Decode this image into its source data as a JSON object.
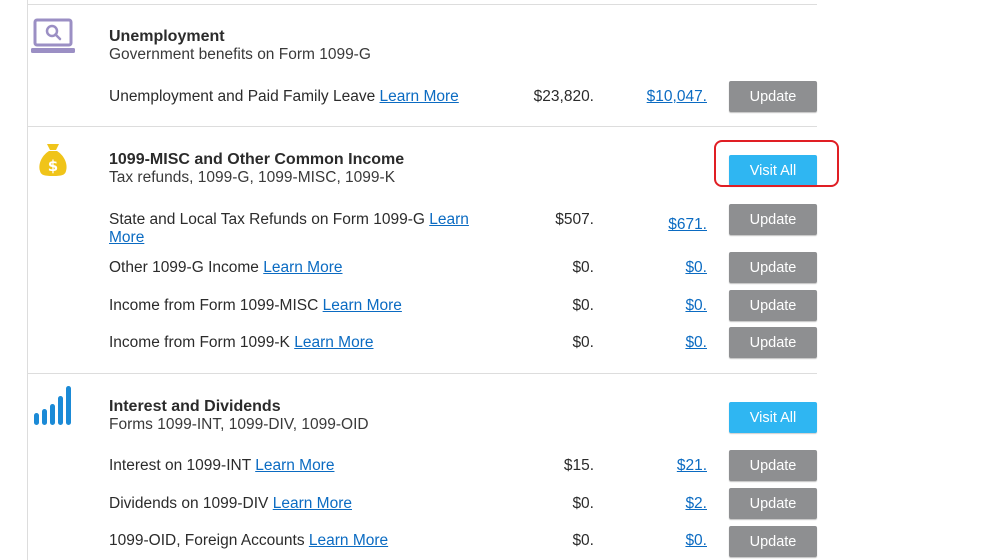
{
  "colors": {
    "accent": "#2fb6f2",
    "update_button": "#8e8f91",
    "link": "#0b6bc2",
    "highlight": "#e01e24",
    "icon": "#9b8fc4",
    "bag_icon": "#f0c419",
    "chart_icon": "#1b8ad6"
  },
  "sections": [
    {
      "icon": "laptop-search-icon",
      "title": "Unemployment",
      "subtitle": "Government benefits on Form 1099-G",
      "rows": [
        {
          "label": "Unemployment and Paid Family Leave",
          "learn": "Learn More",
          "amount": "$23,820.",
          "prior": "$10,047.",
          "button": "Update"
        }
      ]
    },
    {
      "icon": "money-bag-icon",
      "title": "1099-MISC and Other Common Income",
      "subtitle": "Tax refunds, 1099-G, 1099-MISC, 1099-K",
      "visit_all": "Visit All",
      "rows": [
        {
          "label": "State and Local Tax Refunds on Form 1099-G",
          "learn_1": "Learn",
          "learn_2": "More",
          "amount": "$507.",
          "prior": "$671.",
          "button": "Update"
        },
        {
          "label": "Other 1099-G Income",
          "learn": "Learn More",
          "amount": "$0.",
          "prior": "$0.",
          "button": "Update"
        },
        {
          "label": "Income from Form 1099-MISC",
          "learn": "Learn More",
          "amount": "$0.",
          "prior": "$0.",
          "button": "Update"
        },
        {
          "label": "Income from Form 1099-K",
          "learn": "Learn More",
          "amount": "$0.",
          "prior": "$0.",
          "button": "Update"
        }
      ]
    },
    {
      "icon": "bar-chart-icon",
      "title": "Interest and Dividends",
      "subtitle": "Forms 1099-INT, 1099-DIV, 1099-OID",
      "visit_all": "Visit All",
      "rows": [
        {
          "label": "Interest on 1099-INT",
          "learn": "Learn More",
          "amount": "$15.",
          "prior": "$21.",
          "button": "Update"
        },
        {
          "label": "Dividends on 1099-DIV",
          "learn": "Learn More",
          "amount": "$0.",
          "prior": "$2.",
          "button": "Update"
        },
        {
          "label": "1099-OID, Foreign Accounts",
          "learn": "Learn More",
          "amount": "$0.",
          "prior": "$0.",
          "button": "Update"
        }
      ]
    }
  ]
}
